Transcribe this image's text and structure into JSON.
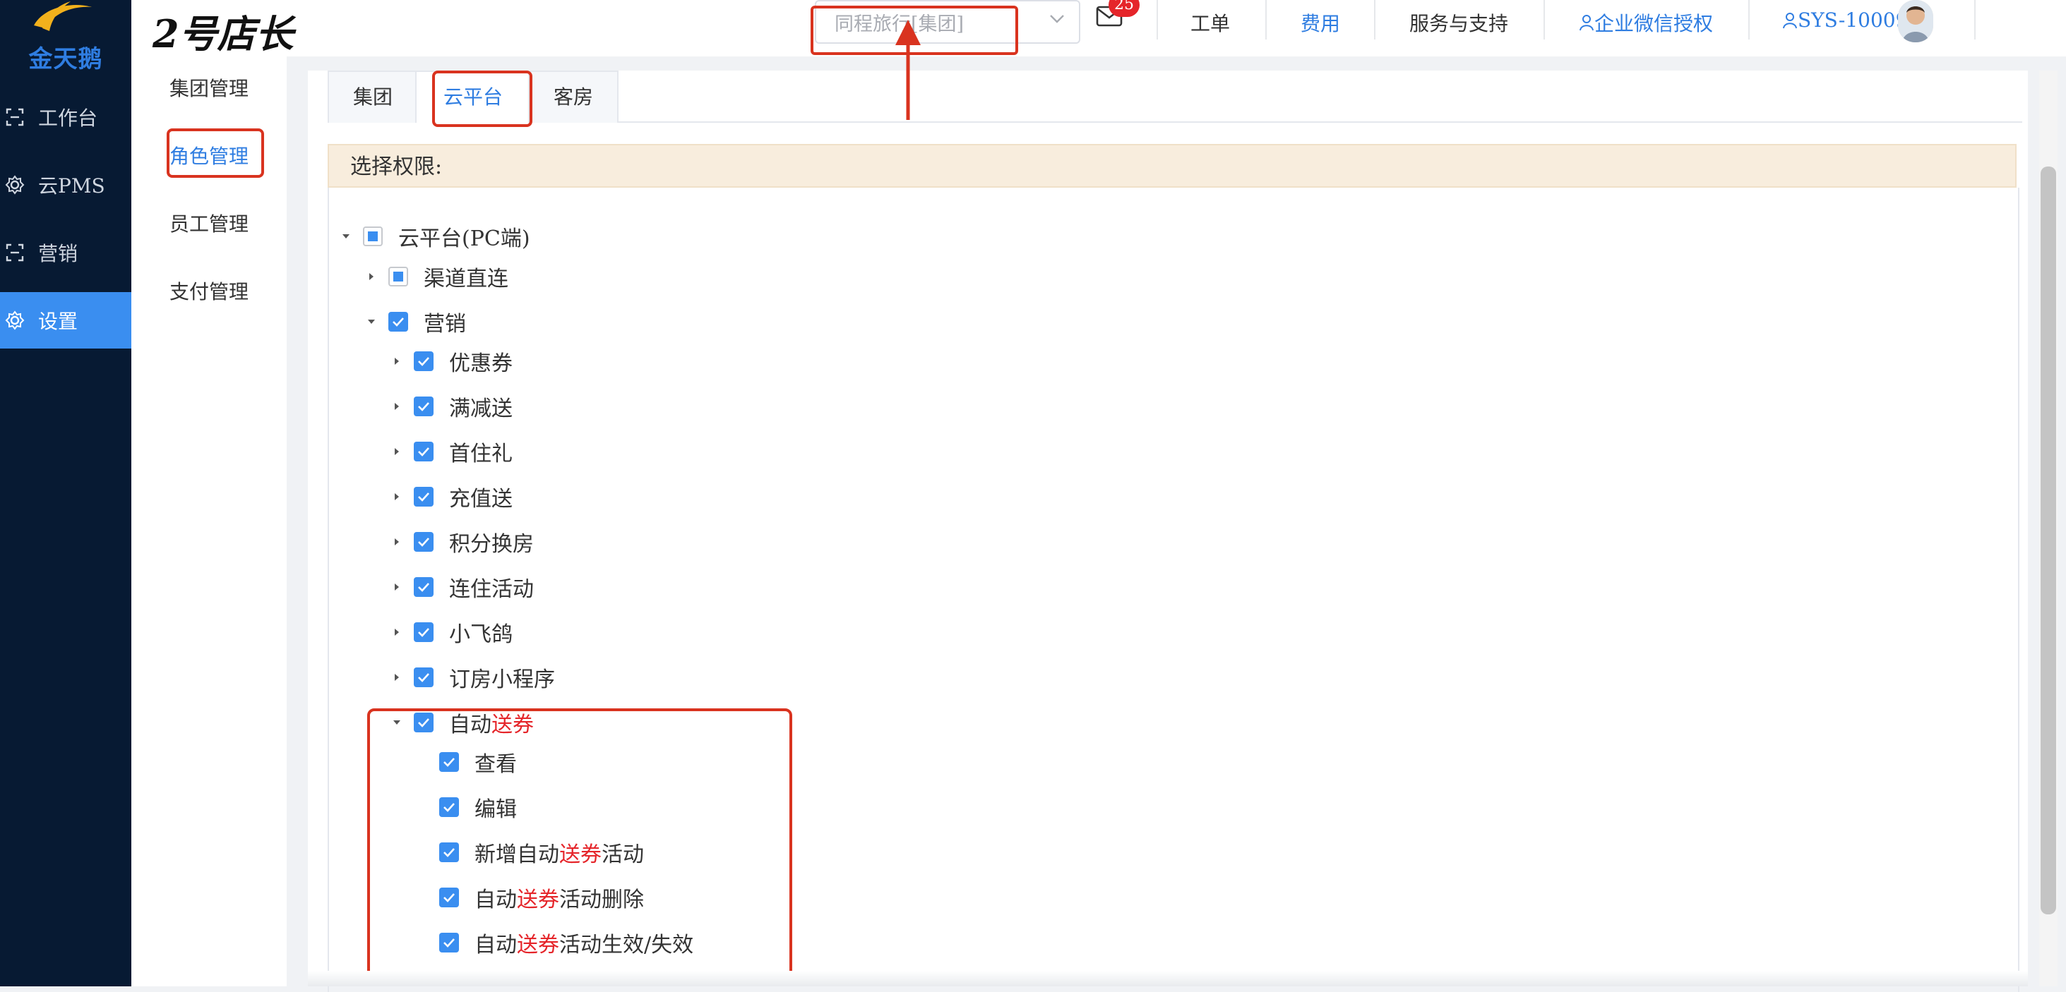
{
  "sidebar": {
    "logo_text": "金天鹅",
    "items": [
      {
        "label": "工作台",
        "icon": "workbench-icon",
        "active": false
      },
      {
        "label": "云PMS",
        "icon": "gear-icon",
        "active": false
      },
      {
        "label": "营销",
        "icon": "marketing-icon",
        "active": false
      },
      {
        "label": "设置",
        "icon": "settings-icon",
        "active": true
      }
    ]
  },
  "header": {
    "brand": "2号店长",
    "org_select": {
      "value": "同程旅行[集团]"
    },
    "mail_badge": "25",
    "links": [
      "工单",
      "费用",
      "服务与支持",
      "企业微信授权",
      "SYS-10009"
    ]
  },
  "submenu": {
    "items": [
      {
        "label": "集团管理",
        "active": false
      },
      {
        "label": "角色管理",
        "active": true
      },
      {
        "label": "员工管理",
        "active": false
      },
      {
        "label": "支付管理",
        "active": false
      }
    ]
  },
  "tabs": [
    {
      "label": "集团",
      "active": false
    },
    {
      "label": "云平台",
      "active": true
    },
    {
      "label": "客房",
      "active": false
    }
  ],
  "permissions": {
    "title": "选择权限:",
    "root": "云平台(PC端)",
    "channel": "渠道直连",
    "marketing": "营销",
    "marketing_children": [
      "优惠券",
      "满减送",
      "首住礼",
      "充值送",
      "积分换房",
      "连住活动",
      "小飞鸽",
      "订房小程序"
    ],
    "auto": {
      "pre": "自动",
      "hl": "送券",
      "post": "",
      "children": [
        {
          "pre": "查看",
          "hl": "",
          "post": ""
        },
        {
          "pre": "编辑",
          "hl": "",
          "post": ""
        },
        {
          "pre": "新增自动",
          "hl": "送券",
          "post": "活动"
        },
        {
          "pre": "自动",
          "hl": "送券",
          "post": "活动删除"
        },
        {
          "pre": "自动",
          "hl": "送券",
          "post": "活动生效/失效"
        }
      ]
    }
  },
  "colors": {
    "accent": "#3a8ef0",
    "sidebar": "#071a33",
    "annotation": "#d9331f",
    "highlight": "#e5252a"
  }
}
